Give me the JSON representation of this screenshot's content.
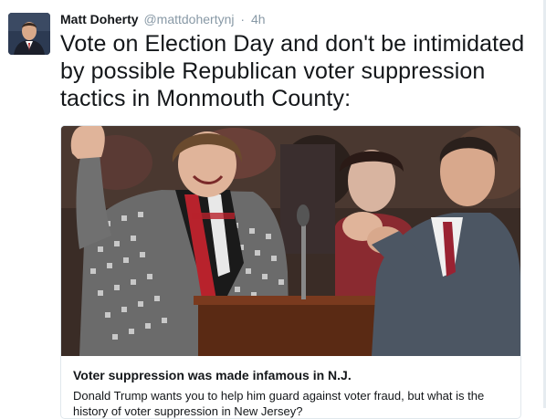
{
  "tweet": {
    "display_name": "Matt Doherty",
    "screen_name": "@mattdohertynj",
    "separator": "·",
    "timestamp": "4h",
    "text": "Vote on Election Day and don't be intimidated by possible Republican voter suppression tactics in Monmouth County:"
  },
  "card": {
    "title": "Voter suppression was made infamous in N.J.",
    "description": "Donald Trump wants you to help him guard against voter fraud, but what is the history of voter suppression in New Jersey?"
  },
  "colors": {
    "text": "#14171a",
    "secondary": "#8899a6",
    "border": "#e1e8ed"
  }
}
